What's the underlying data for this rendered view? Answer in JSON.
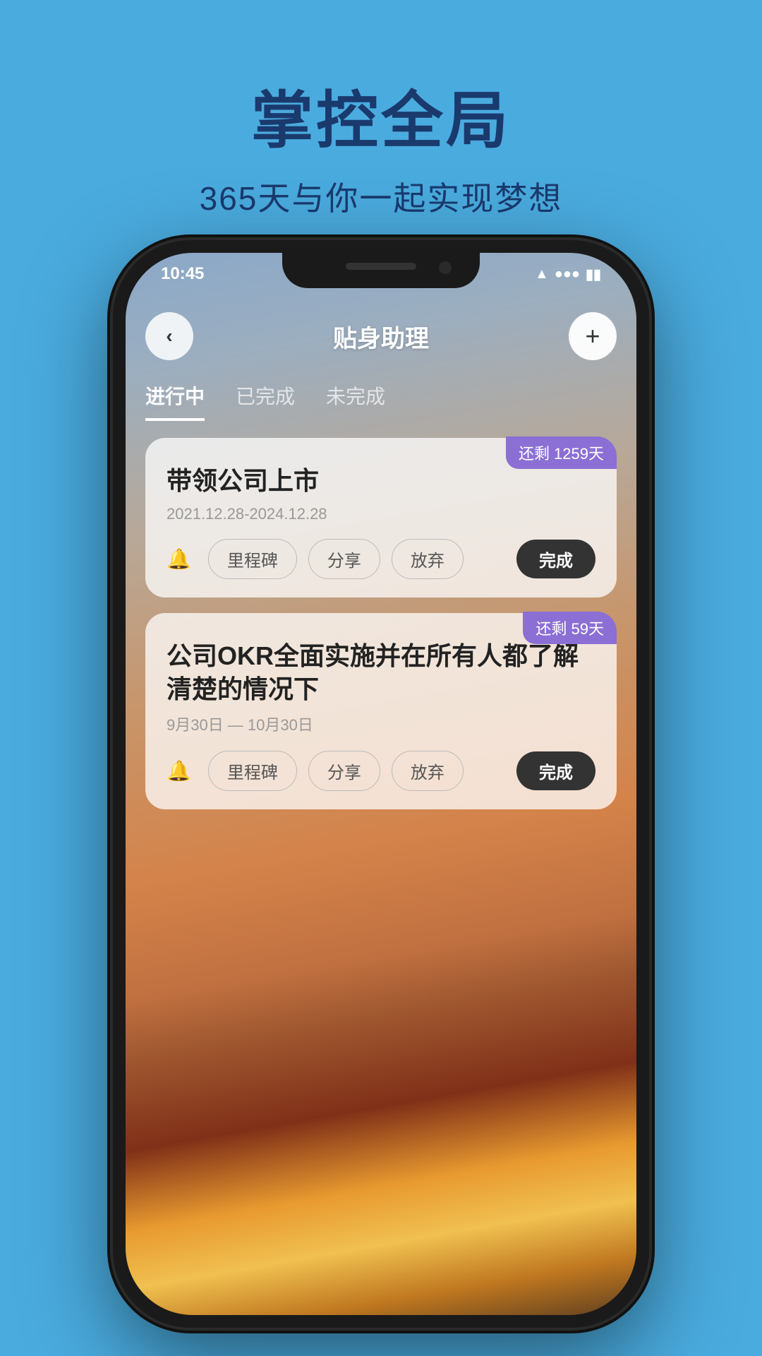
{
  "hero": {
    "title": "掌控全局",
    "subtitle": "365天与你一起实现梦想"
  },
  "phone": {
    "status_bar": {
      "time": "10:45",
      "icons": "●●●"
    },
    "header": {
      "back_label": "‹",
      "title": "贴身助理",
      "add_label": "+"
    },
    "tabs": [
      {
        "label": "进行中",
        "active": true
      },
      {
        "label": "已完成",
        "active": false
      },
      {
        "label": "未完成",
        "active": false
      }
    ],
    "cards": [
      {
        "badge": "还剩 1259天",
        "title": "带领公司上市",
        "date": "2021.12.28-2024.12.28",
        "actions": [
          "里程碑",
          "分享",
          "放弃"
        ],
        "complete": "完成"
      },
      {
        "badge": "还剩 59天",
        "title": "公司OKR全面实施并在所有人都了解清楚的情况下",
        "date": "9月30日 — 10月30日",
        "actions": [
          "里程碑",
          "分享",
          "放弃"
        ],
        "complete": "完成"
      }
    ]
  }
}
